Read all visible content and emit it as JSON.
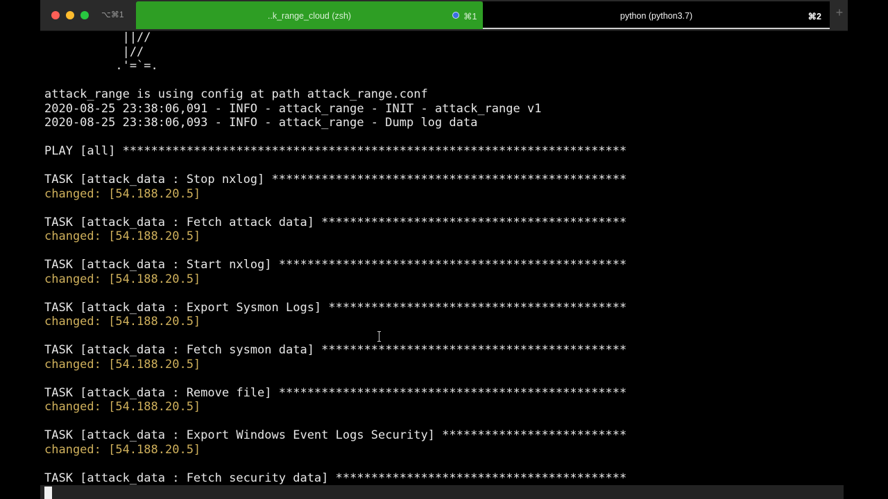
{
  "titlebar": {
    "window_shortcut": "⌥⌘1",
    "tabs": [
      {
        "title": "..k_range_cloud (zsh)",
        "shortcut": "⌘1"
      },
      {
        "title": "python (python3.7)",
        "shortcut": "⌘2"
      }
    ],
    "new_tab_label": "+"
  },
  "colors": {
    "tab_active_green": "#2e9e24",
    "changed_text": "#d0b15c",
    "terminal_bg": "#000000"
  },
  "terminal": {
    "lines": [
      {
        "text": "           ||//",
        "kind": "normal"
      },
      {
        "text": "           |//",
        "kind": "normal"
      },
      {
        "text": "          .'=`=.",
        "kind": "normal"
      },
      {
        "text": "",
        "kind": "normal"
      },
      {
        "text": "attack_range is using config at path attack_range.conf",
        "kind": "normal"
      },
      {
        "text": "2020-08-25 23:38:06,091 - INFO - attack_range - INIT - attack_range v1",
        "kind": "normal"
      },
      {
        "text": "2020-08-25 23:38:06,093 - INFO - attack_range - Dump log data",
        "kind": "normal"
      },
      {
        "text": "",
        "kind": "normal"
      },
      {
        "text": "PLAY [all] ***********************************************************************",
        "kind": "normal"
      },
      {
        "text": "",
        "kind": "normal"
      },
      {
        "text": "TASK [attack_data : Stop nxlog] **************************************************",
        "kind": "normal"
      },
      {
        "text": "changed: [54.188.20.5]",
        "kind": "changed"
      },
      {
        "text": "",
        "kind": "normal"
      },
      {
        "text": "TASK [attack_data : Fetch attack data] *******************************************",
        "kind": "normal"
      },
      {
        "text": "changed: [54.188.20.5]",
        "kind": "changed"
      },
      {
        "text": "",
        "kind": "normal"
      },
      {
        "text": "TASK [attack_data : Start nxlog] *************************************************",
        "kind": "normal"
      },
      {
        "text": "changed: [54.188.20.5]",
        "kind": "changed"
      },
      {
        "text": "",
        "kind": "normal"
      },
      {
        "text": "TASK [attack_data : Export Sysmon Logs] ******************************************",
        "kind": "normal"
      },
      {
        "text": "changed: [54.188.20.5]",
        "kind": "changed"
      },
      {
        "text": "",
        "kind": "normal"
      },
      {
        "text": "TASK [attack_data : Fetch sysmon data] *******************************************",
        "kind": "normal"
      },
      {
        "text": "changed: [54.188.20.5]",
        "kind": "changed"
      },
      {
        "text": "",
        "kind": "normal"
      },
      {
        "text": "TASK [attack_data : Remove file] *************************************************",
        "kind": "normal"
      },
      {
        "text": "changed: [54.188.20.5]",
        "kind": "changed"
      },
      {
        "text": "",
        "kind": "normal"
      },
      {
        "text": "TASK [attack_data : Export Windows Event Logs Security] **************************",
        "kind": "normal"
      },
      {
        "text": "changed: [54.188.20.5]",
        "kind": "changed"
      },
      {
        "text": "",
        "kind": "normal"
      },
      {
        "text": "TASK [attack_data : Fetch security data] *****************************************",
        "kind": "normal"
      }
    ]
  }
}
